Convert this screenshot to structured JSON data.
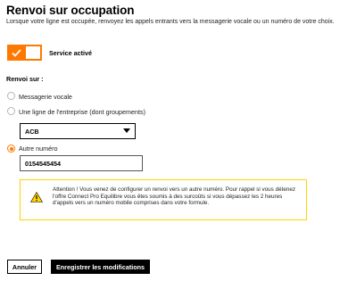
{
  "header": {
    "title": "Renvoi sur occupation",
    "subtitle": "Lorsque votre ligne est occupée, renvoyez les appels entrants vers la messagerie vocale ou un numéro de votre choix."
  },
  "service": {
    "toggle_on": true,
    "label": "Service activé"
  },
  "forward": {
    "section_label": "Renvoi sur :",
    "options": [
      {
        "label": "Messagerie vocale",
        "checked": false
      },
      {
        "label": "Une ligne de l'entreprise (dont groupements)",
        "checked": false
      },
      {
        "label": "Autre numéro",
        "checked": true
      }
    ],
    "company_line_select": {
      "value": "ACB"
    },
    "other_number_input": {
      "value": "0154545454"
    }
  },
  "alert": {
    "icon": "warning-icon",
    "text": "Attention ! Vous venez de configurer un renvoi vers un autre numéro. Pour rappel si vous détenez l'offre Connect Pro Equilibre vous êtes soumis à des surcoûts si vous dépassez les 2 heures d'appels vers un numéro mobile comprises dans votre formule."
  },
  "actions": {
    "cancel_label": "Annuler",
    "save_label": "Enregistrer les modifications"
  },
  "colors": {
    "accent": "#ff7900",
    "warning_border": "#ffd200",
    "primary_button": "#000000"
  }
}
